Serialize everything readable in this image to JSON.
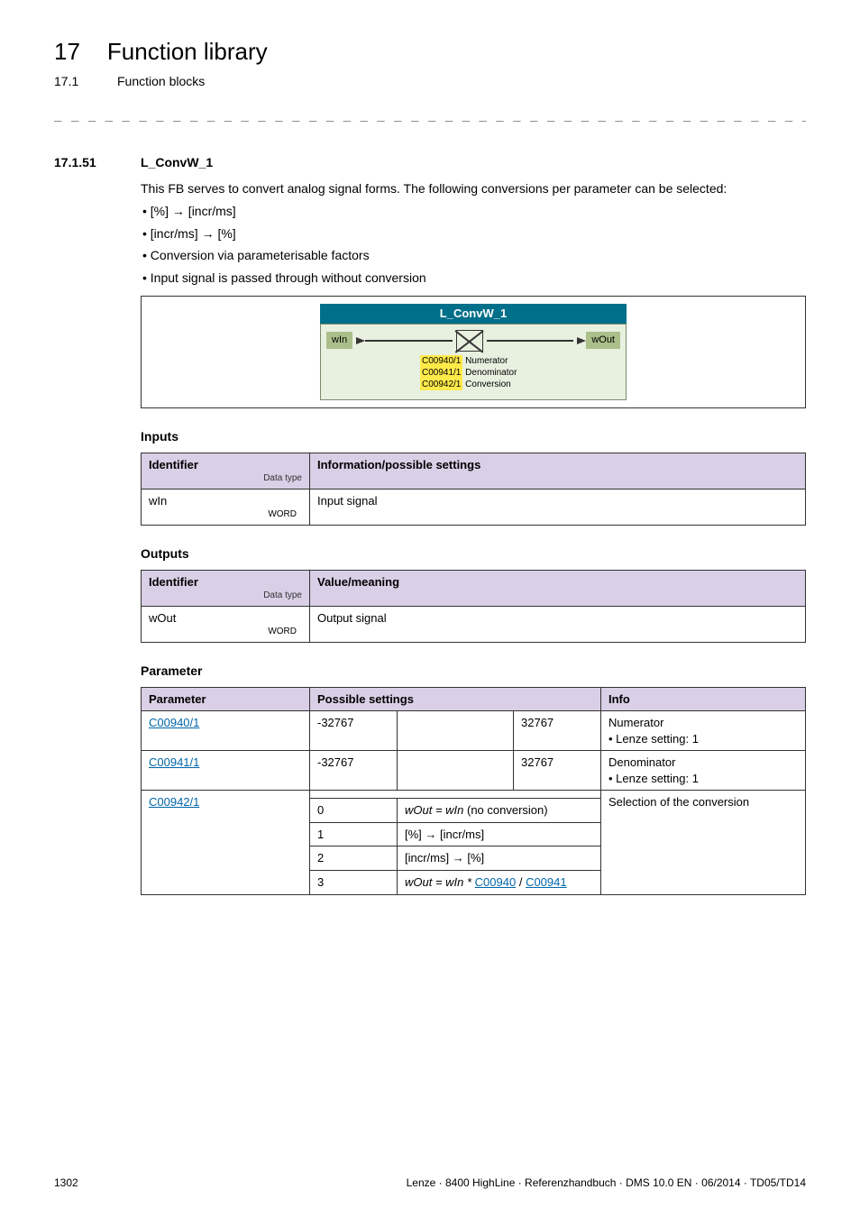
{
  "chapter": {
    "num": "17",
    "title": "Function library"
  },
  "subchapter": {
    "num": "17.1",
    "title": "Function blocks"
  },
  "dashes": "_ _ _ _ _ _ _ _ _ _ _ _ _ _ _ _ _ _ _ _ _ _ _ _ _ _ _ _ _ _ _ _ _ _ _ _ _ _ _ _ _ _ _ _ _ _ _ _ _ _ _ _ _ _ _ _ _ _ _ _ _ _ _ _",
  "section": {
    "num": "17.1.51",
    "title": "L_ConvW_1"
  },
  "intro": "This FB serves to convert analog signal forms. The following conversions per parameter can be selected:",
  "bullets": [
    "[%] → [incr/ms]",
    "[incr/ms] → [%]",
    "Conversion via parameterisable factors",
    "Input signal is passed through without conversion"
  ],
  "diagram": {
    "title": "L_ConvW_1",
    "in": "wIn",
    "out": "wOut",
    "p1": {
      "code": "C00940/1",
      "label": "Numerator"
    },
    "p2": {
      "code": "C00941/1",
      "label": "Denominator"
    },
    "p3": {
      "code": "C00942/1",
      "label": "Conversion"
    }
  },
  "inputs": {
    "heading": "Inputs",
    "th_id": "Identifier",
    "th_dt": "Data type",
    "th_info": "Information/possible settings",
    "rows": [
      {
        "id": "wIn",
        "dt": "WORD",
        "info": "Input signal"
      }
    ]
  },
  "outputs": {
    "heading": "Outputs",
    "th_id": "Identifier",
    "th_dt": "Data type",
    "th_info": "Value/meaning",
    "rows": [
      {
        "id": "wOut",
        "dt": "WORD",
        "info": "Output signal"
      }
    ]
  },
  "params": {
    "heading": "Parameter",
    "th_param": "Parameter",
    "th_ps": "Possible settings",
    "th_info": "Info",
    "r1": {
      "param": "C00940/1",
      "min": "-32767",
      "max": "32767",
      "info1": "Numerator",
      "info2": "• Lenze setting: 1"
    },
    "r2": {
      "param": "C00941/1",
      "min": "-32767",
      "max": "32767",
      "info1": "Denominator",
      "info2": "• Lenze setting: 1"
    },
    "r3": {
      "param": "C00942/1",
      "info": "Selection of the conversion",
      "opt0": {
        "n": "0",
        "txt_pre": "wOut = wIn",
        "txt_post": " (no conversion)"
      },
      "opt1": {
        "n": "1",
        "txt": "[%] → [incr/ms]"
      },
      "opt2": {
        "n": "2",
        "txt": "[incr/ms] → [%]"
      },
      "opt3": {
        "n": "3",
        "pre": "wOut = wIn * ",
        "l1": "C00940",
        "sep": " / ",
        "l2": "C00941"
      }
    }
  },
  "footer": {
    "page": "1302",
    "right": "Lenze · 8400 HighLine · Referenzhandbuch · DMS 10.0 EN · 06/2014 · TD05/TD14"
  }
}
